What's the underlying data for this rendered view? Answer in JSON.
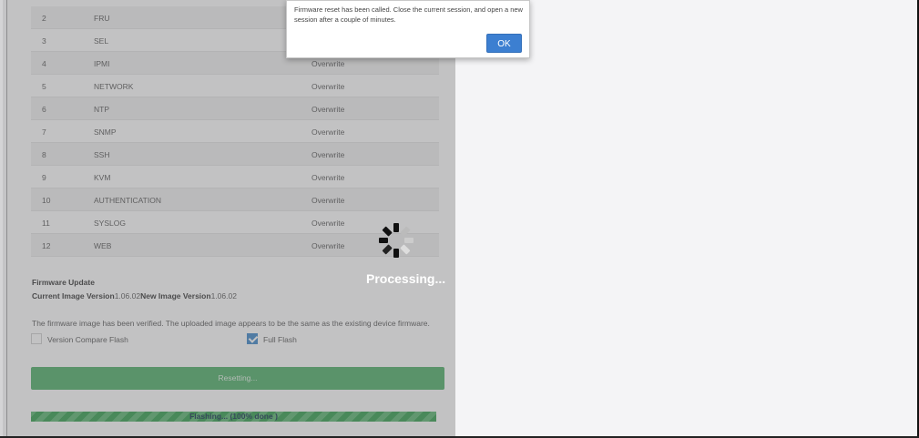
{
  "table": {
    "rows": [
      {
        "num": "2",
        "name": "FRU",
        "action": ""
      },
      {
        "num": "3",
        "name": "SEL",
        "action": ""
      },
      {
        "num": "4",
        "name": "IPMI",
        "action": "Overwrite"
      },
      {
        "num": "5",
        "name": "NETWORK",
        "action": "Overwrite"
      },
      {
        "num": "6",
        "name": "NTP",
        "action": "Overwrite"
      },
      {
        "num": "7",
        "name": "SNMP",
        "action": "Overwrite"
      },
      {
        "num": "8",
        "name": "SSH",
        "action": "Overwrite"
      },
      {
        "num": "9",
        "name": "KVM",
        "action": "Overwrite"
      },
      {
        "num": "10",
        "name": "AUTHENTICATION",
        "action": "Overwrite"
      },
      {
        "num": "11",
        "name": "SYSLOG",
        "action": "Overwrite"
      },
      {
        "num": "12",
        "name": "WEB",
        "action": "Overwrite"
      }
    ]
  },
  "firmware": {
    "title": "Firmware Update",
    "current_label": "Current Image Version",
    "current_value": "1.06.02",
    "new_label": "New Image Version",
    "new_value": "1.06.02",
    "message": "The firmware image has been verified. The uploaded image appears to be the same as the existing device firmware."
  },
  "options": {
    "version_compare": {
      "label": "Version Compare Flash",
      "checked": false
    },
    "full_flash": {
      "label": "Full Flash",
      "checked": true
    }
  },
  "reset_button": {
    "label": "Resetting..."
  },
  "progress": {
    "label": "Flashing... (100% done )",
    "percent": 100
  },
  "processing": {
    "label": "Processing..."
  },
  "dialog": {
    "message": "Firmware reset has been called. Close the current session, and open a new session after a couple of minutes.",
    "ok_label": "OK"
  },
  "colors": {
    "success_green": "#4cae66",
    "primary_blue": "#3c7fd1",
    "overlay_gray": "#8c8c8e"
  }
}
